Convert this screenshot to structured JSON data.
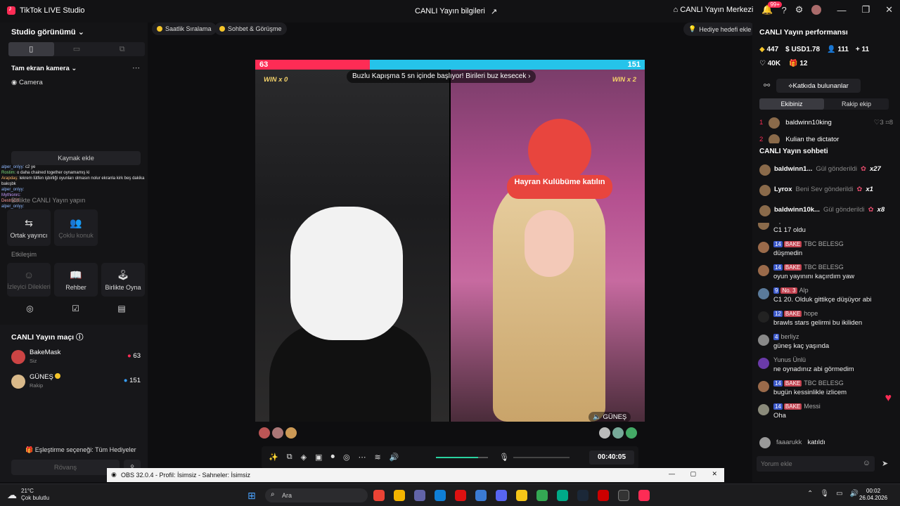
{
  "titlebar": {
    "app": "TikTok LIVE Studio",
    "center": "CANLI Yayın bilgileri",
    "center_link": "CANLI Yayın Merkezi",
    "badge": "99+"
  },
  "left": {
    "studio_view": "Studio görünümü",
    "camera_mode": "Tam ekran kamera",
    "camera": "Camera",
    "add_source": "Kaynak ekle",
    "overlay_chat": [
      {
        "name": "alper_onlyy:",
        "text": "c2 ye"
      },
      {
        "name": "Rostim:",
        "text": "o daha chained together oynamamış ki"
      },
      {
        "name": "Arapdaş:",
        "text": "lekrem lütfen işbirliği oyunları olmasın nolur ekranla kirk beş dakika bakışbk"
      },
      {
        "name": "alper_onlyy:",
        "text": ""
      },
      {
        "name": "Mythionrc:",
        "text": ""
      },
      {
        "name": "Destrix35:",
        "text": ""
      },
      {
        "name": "alper_onlyy:",
        "text": ""
      }
    ],
    "together_title": "Birlikte CANLI Yayın yapın",
    "cohost": "Ortak yayıncı",
    "multi": "Çoklu konuk",
    "interaction": "Etkileşim",
    "tiles": [
      {
        "label": "İzleyici Dilekleri",
        "dim": true
      },
      {
        "label": "Rehber",
        "dim": false
      },
      {
        "label": "Birlikte Oyna",
        "dim": false
      }
    ],
    "match_title": "CANLI Yayın maçı",
    "players": [
      {
        "name": "BakeMask",
        "role": "Siz",
        "score": "63"
      },
      {
        "name": "GÜNEŞ",
        "role": "Rakip",
        "score": "151"
      }
    ],
    "match_option": "Eşleştirme seçeneği: Tüm Hediyeler",
    "rematch": "Rövanş"
  },
  "topchips": {
    "hourly": "Saatlik Sıralama",
    "chat": "Sohbet & Görüşme",
    "gift_goal": "Hediye hedefi ekle"
  },
  "stage": {
    "score_left": "63",
    "score_right": "151",
    "banner": "Buzlu Kapışma 5 sn içinde başlıyor! Birileri buz kesecek",
    "win_left": "WIN x 0",
    "win_right": "WIN x 2",
    "sign": "Hayran Kulübüme katılın",
    "opponent_label": "GÜNEŞ",
    "timer": "00:40:05"
  },
  "right": {
    "perf_title": "CANLI Yayın performansı",
    "stats": [
      "447",
      "USD1.78",
      "111",
      "11",
      "40K",
      "12"
    ],
    "contributors": "Katkıda bulunanlar",
    "tabs": [
      "Ekibiniz",
      "Rakip ekip"
    ],
    "team": [
      {
        "rank": "1",
        "name": "baldwinn10king",
        "a": "3",
        "b": "8"
      },
      {
        "rank": "2",
        "name": "Kulian the dictator",
        "a": "",
        "b": ""
      }
    ],
    "chat_title": "CANLI Yayın sohbeti",
    "gifts": [
      {
        "name": "baldwinn1...",
        "text": "Gül gönderildi",
        "count": "x27"
      },
      {
        "name": "Lyrox",
        "text": "Beni Sev gönderildi",
        "count": "x1"
      },
      {
        "name": "baldwinn10k...",
        "text": "Gül gönderildi",
        "count": "x8"
      }
    ],
    "messages": [
      {
        "lv": "",
        "fan": "",
        "name": "Alp",
        "msg": "C1 17 oldu"
      },
      {
        "lv": "14",
        "fan": "BAKE",
        "name": "TBC BELESG",
        "msg": "düşmedin"
      },
      {
        "lv": "14",
        "fan": "BAKE",
        "name": "TBC BELESG",
        "msg": "oyun yayınını kaçırdım yaw"
      },
      {
        "lv": "9",
        "fan": "No. 3",
        "name": "Alp",
        "msg": "C1 20. Olduk gittikçe düşüyor abi"
      },
      {
        "lv": "12",
        "fan": "BAKE",
        "name": "hope",
        "msg": "brawls stars gelirmi bu ikiliden"
      },
      {
        "lv": "4",
        "fan": "",
        "name": "berliyz",
        "msg": "güneş kaç yaşında"
      },
      {
        "lv": "",
        "fan": "",
        "name": "Yunus Ünlü",
        "msg": "ne oynadınız abi görmedim"
      },
      {
        "lv": "14",
        "fan": "BAKE",
        "name": "TBC BELESG",
        "msg": "bugün kessinlikle izlicem"
      },
      {
        "lv": "14",
        "fan": "BAKE",
        "name": "Messi",
        "msg": "Oha"
      }
    ],
    "joined_name": "faaarukk",
    "joined": "katıldı",
    "comment_placeholder": "Yorum ekle"
  },
  "obs": {
    "title": "OBS 32.0.4 - Profil: İsimsiz - Sahneler: İsimsiz"
  },
  "taskbar": {
    "temp": "21°C",
    "weather": "Çok bulutlu",
    "search": "Ara",
    "time": "00:02",
    "date": "26.04.2026"
  }
}
